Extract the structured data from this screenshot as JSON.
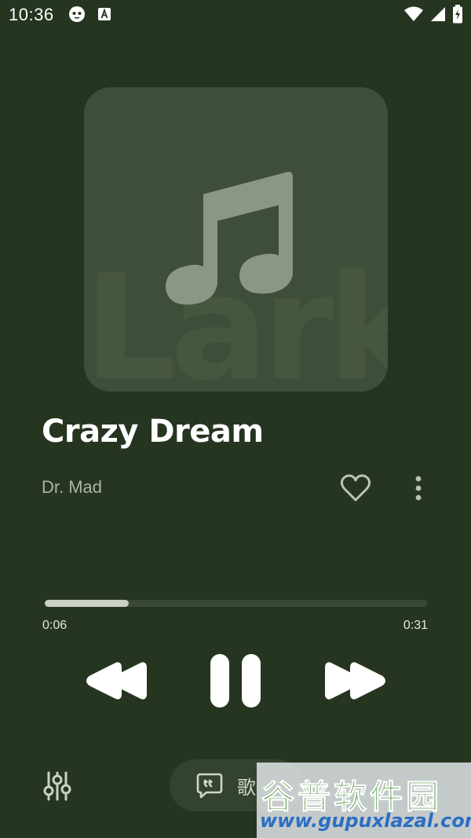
{
  "status_bar": {
    "time": "10:36",
    "left_icons": [
      "mascot-notification-icon",
      "a-box-notification-icon"
    ],
    "right_icons": [
      "wifi-icon",
      "cell-signal-icon",
      "battery-icon"
    ]
  },
  "album": {
    "watermark_text": "Lark",
    "icon": "music-note-icon"
  },
  "track": {
    "title": "Crazy Dream",
    "artist": "Dr. Mad",
    "liked": false
  },
  "progress": {
    "current": "0:06",
    "total": "0:31",
    "fraction": 0.22
  },
  "controls": {
    "rewind_icon": "rewind-icon",
    "pause_icon": "pause-icon",
    "forward_icon": "fast-forward-icon",
    "equalizer_icon": "equalizer-icon"
  },
  "lyrics": {
    "label": "歌"
  },
  "watermark": {
    "site_name": "谷普软件园",
    "site_url": "www.gupuxlazal.com"
  },
  "colors": {
    "background": "#263520",
    "album_bg": "#3f4e39",
    "progress_fill": "#c9d1c4",
    "progress_track": "#3a4933"
  }
}
